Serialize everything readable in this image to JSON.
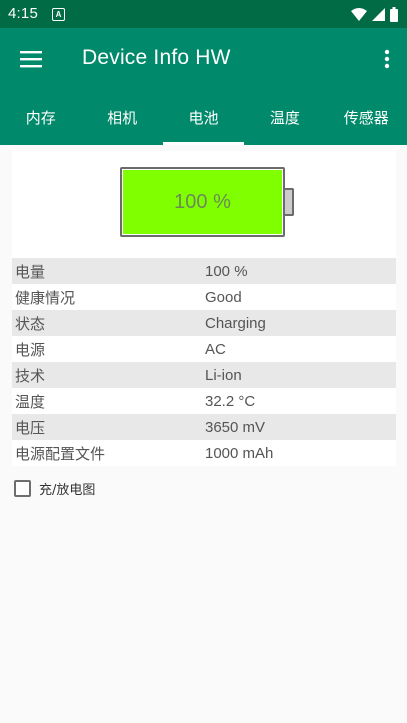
{
  "status_bar": {
    "time": "4:15",
    "notification_letter": "A",
    "icons": [
      "wifi-icon",
      "signal-icon",
      "battery-icon"
    ]
  },
  "app_bar": {
    "title": "Device Info HW",
    "menu_icon": "hamburger-menu-icon",
    "more_icon": "more-vert-icon"
  },
  "tabs": [
    {
      "label": "内存",
      "active": false
    },
    {
      "label": "相机",
      "active": false
    },
    {
      "label": "电池",
      "active": true
    },
    {
      "label": "温度",
      "active": false
    },
    {
      "label": "传感器",
      "active": false
    }
  ],
  "battery": {
    "level_text": "100 %",
    "level_fraction": 1.0,
    "fill_color": "#80ff00"
  },
  "info_rows": [
    {
      "label": "电量",
      "value": "100 %"
    },
    {
      "label": "健康情况",
      "value": "Good"
    },
    {
      "label": "状态",
      "value": "Charging"
    },
    {
      "label": "电源",
      "value": "AC"
    },
    {
      "label": "技术",
      "value": "Li-ion"
    },
    {
      "label": "温度",
      "value": "32.2 °C"
    },
    {
      "label": "电压",
      "value": "3650 mV"
    },
    {
      "label": "电源配置文件",
      "value": "1000 mAh"
    }
  ],
  "chart_toggle": {
    "label": "充/放电图",
    "checked": false
  },
  "colors": {
    "status_bar": "#006b45",
    "app_bar": "#00896a",
    "row_shade": "#e8e8e8"
  }
}
